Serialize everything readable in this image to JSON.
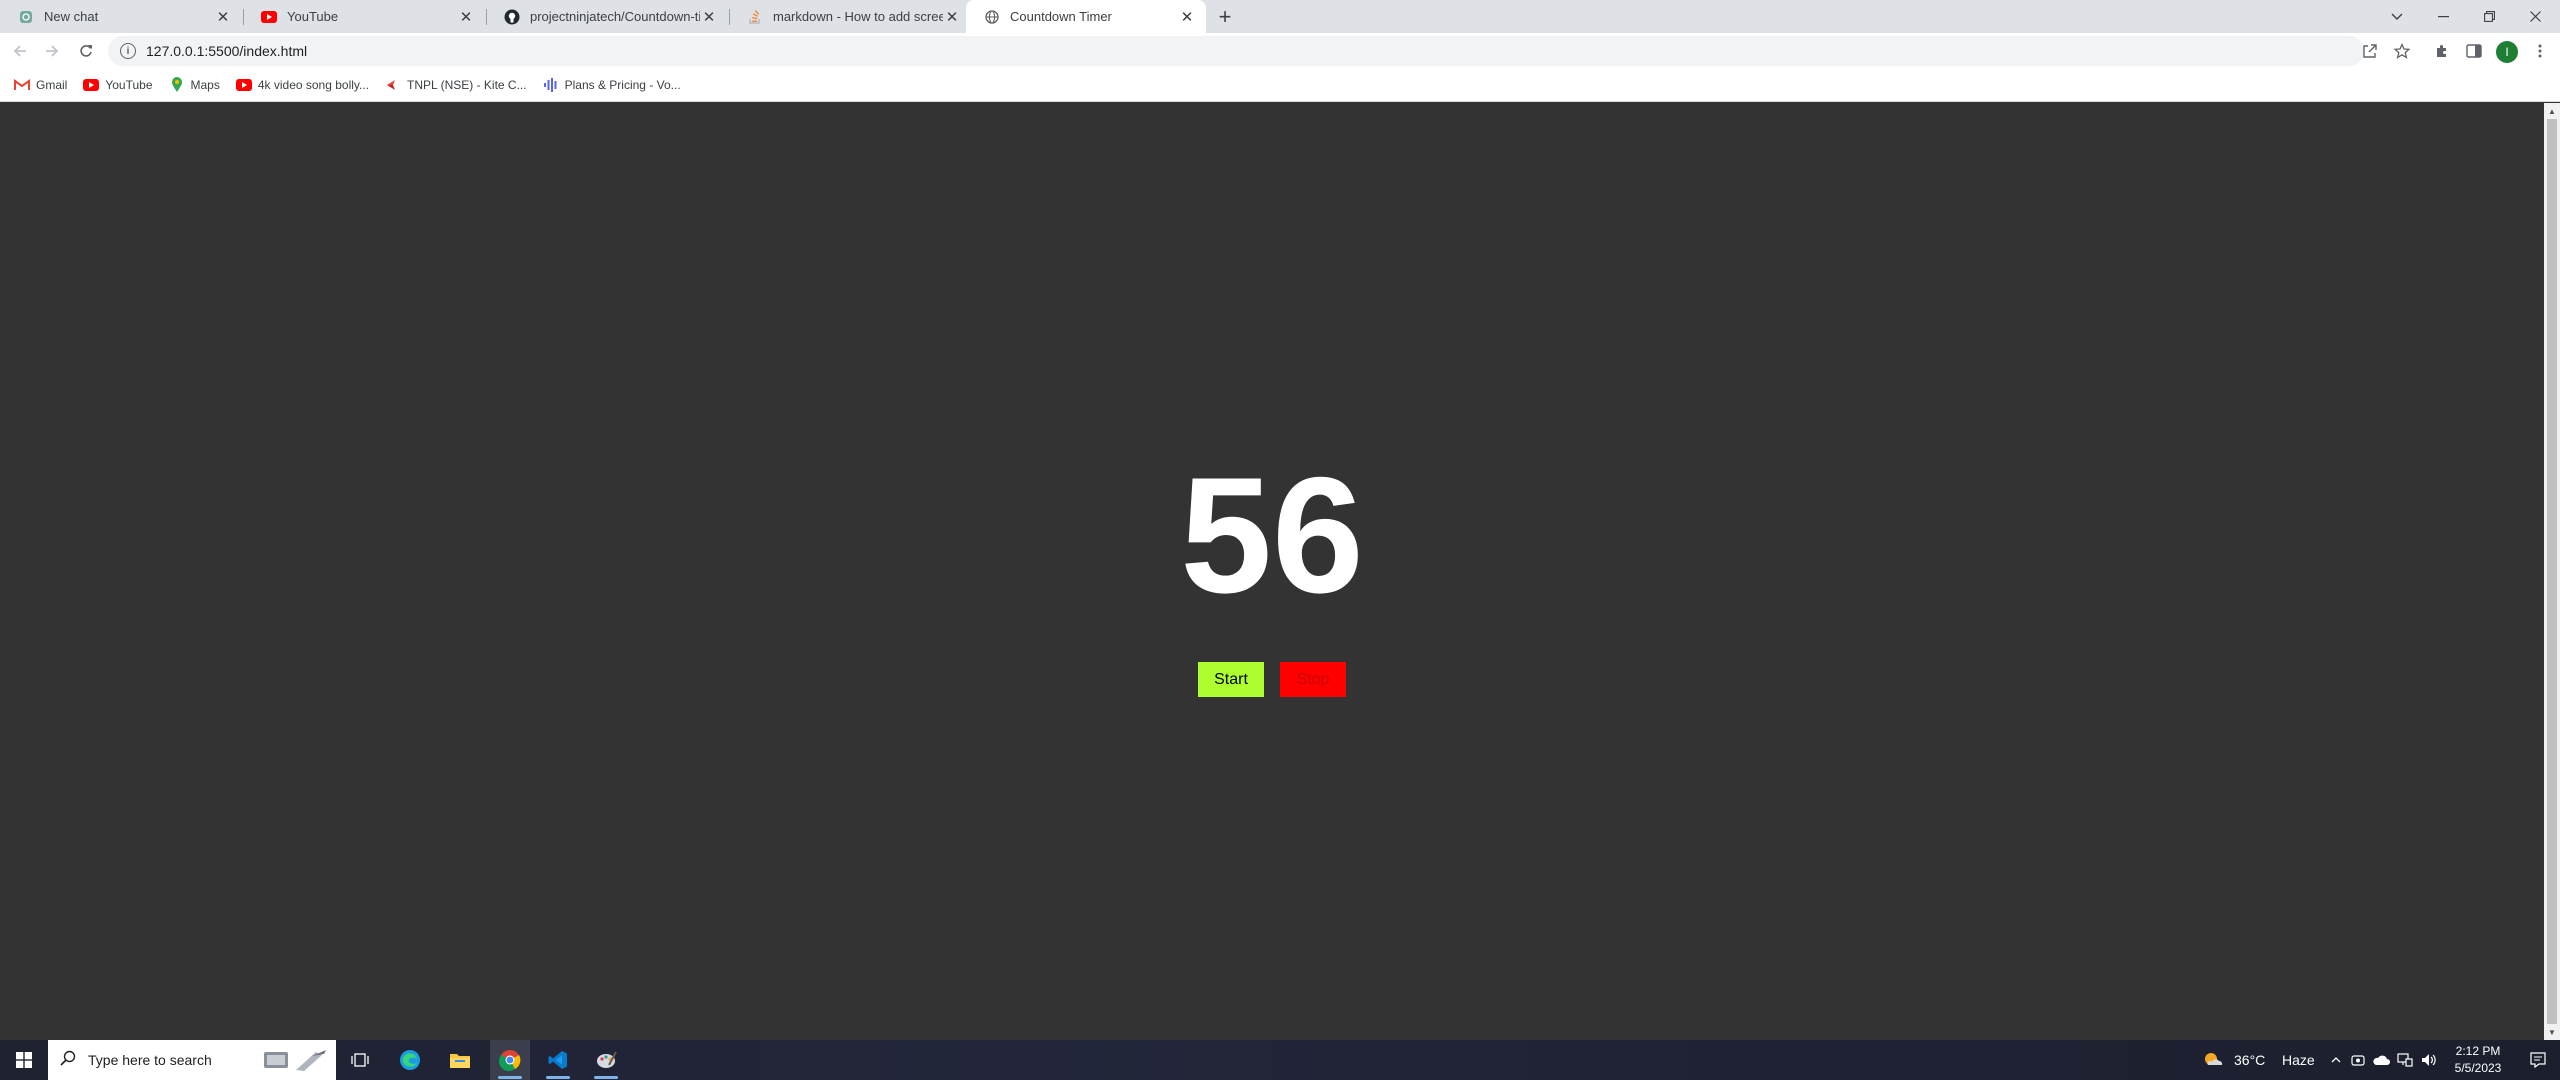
{
  "browser": {
    "tabs": [
      {
        "title": "New chat",
        "icon": "chatgpt-icon"
      },
      {
        "title": "YouTube",
        "icon": "youtube-icon"
      },
      {
        "title": "projectninjatech/Countdown-timer",
        "icon": "github-icon"
      },
      {
        "title": "markdown - How to add screenshot",
        "icon": "stackoverflow-icon"
      },
      {
        "title": "Countdown Timer",
        "icon": "globe-icon",
        "active": true
      }
    ],
    "url": "127.0.0.1:5500/index.html",
    "profile_initial": "I",
    "bookmarks": [
      {
        "label": "Gmail",
        "icon": "gmail-icon"
      },
      {
        "label": "YouTube",
        "icon": "youtube-icon"
      },
      {
        "label": "Maps",
        "icon": "maps-icon"
      },
      {
        "label": "4k video song bolly...",
        "icon": "youtube-icon"
      },
      {
        "label": "TNPL (NSE) - Kite C...",
        "icon": "kite-icon"
      },
      {
        "label": "Plans & Pricing - Vo...",
        "icon": "audio-icon"
      }
    ]
  },
  "page": {
    "countdown": "56",
    "start_label": "Start",
    "stop_label": "Stop",
    "colors": {
      "background": "#333333",
      "start": "#adff2f",
      "stop": "#ff0000"
    }
  },
  "taskbar": {
    "search_placeholder": "Type here to search",
    "weather_temp": "36°C",
    "weather_desc": "Haze",
    "time": "2:12 PM",
    "date": "5/5/2023"
  }
}
